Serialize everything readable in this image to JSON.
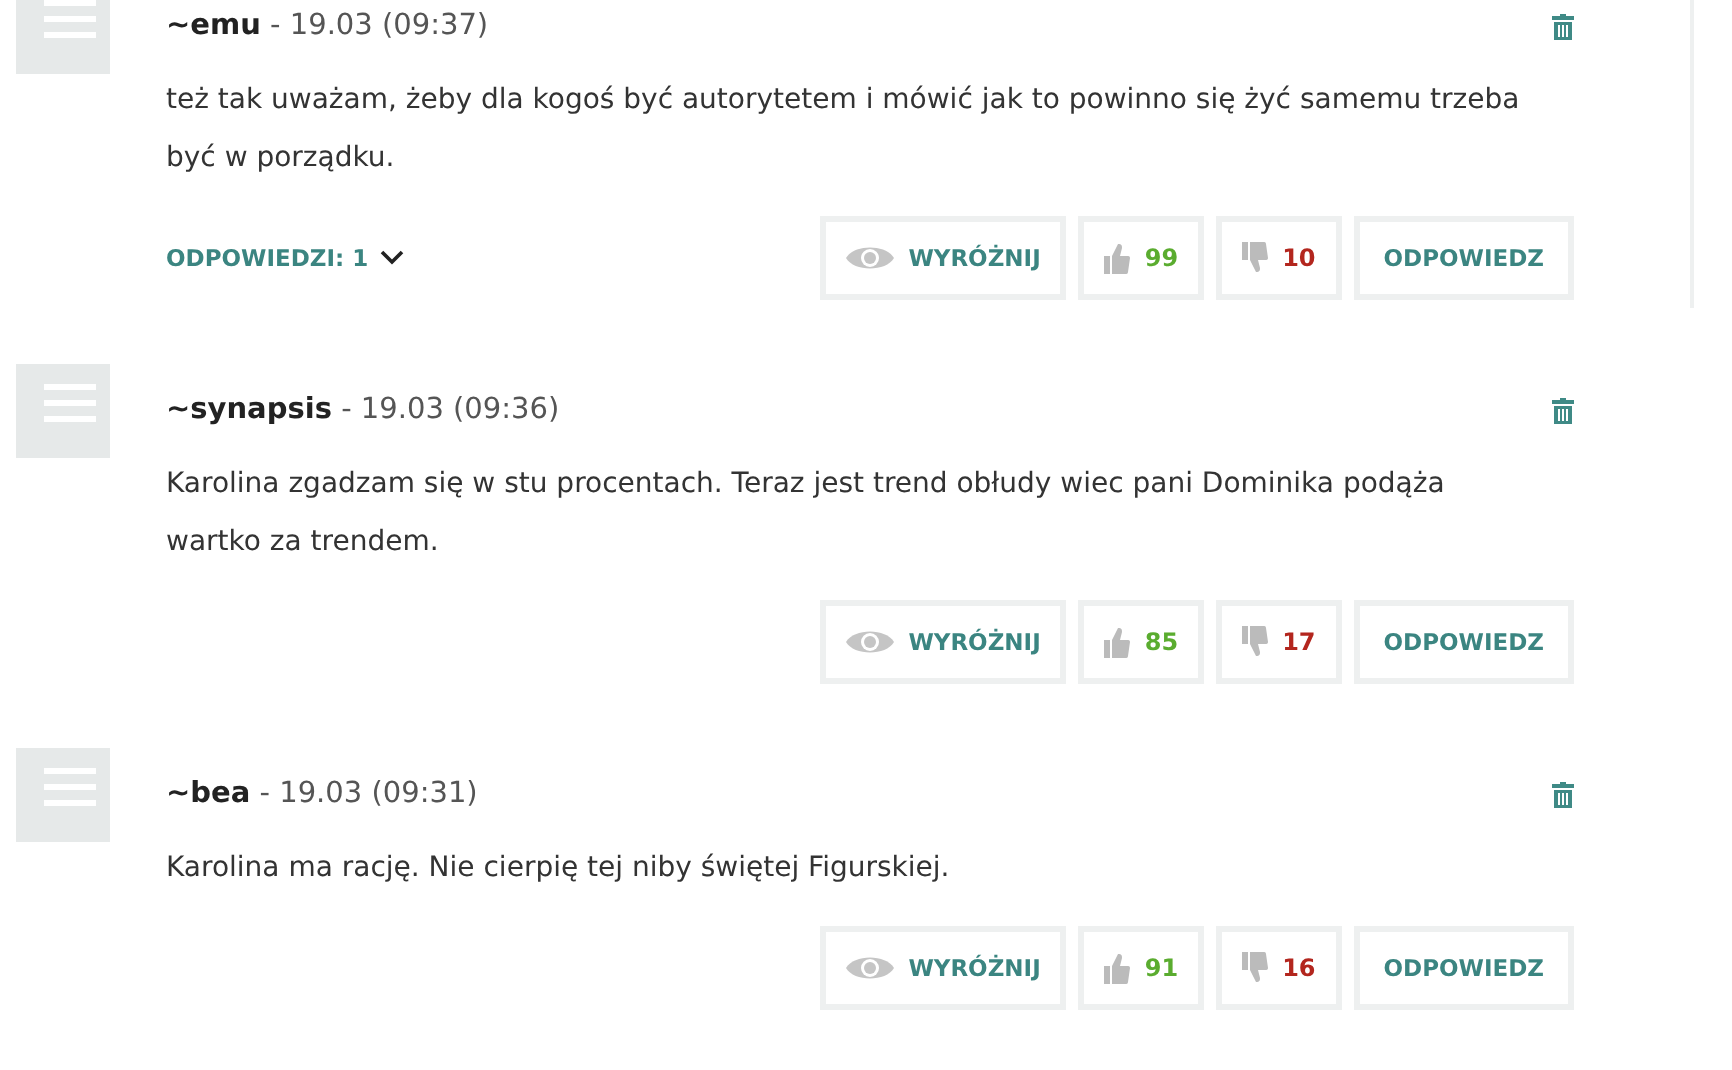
{
  "comments": [
    {
      "author": "~emu",
      "date": "- 19.03 (09:37)",
      "text": "też tak uważam, żeby dla kogoś być autorytetem i mówić jak to powinno się żyć samemu trzeba być w porządku.",
      "replies": {
        "label": "ODPOWIEDZI: 1",
        "expanded": false
      },
      "thread_line": true,
      "highlight": "WYRÓŻNIJ",
      "likes": "99",
      "dislikes": "10",
      "reply": "ODPOWIEDZ"
    },
    {
      "author": "~synapsis",
      "date": "- 19.03 (09:36)",
      "text": "Karolina zgadzam się w stu procentach. Teraz jest trend obłudy wiec pani Dominika podąża wartko za trendem.",
      "thread_line": false,
      "highlight": "WYRÓŻNIJ",
      "likes": "85",
      "dislikes": "17",
      "reply": "ODPOWIEDZ"
    },
    {
      "author": "~bea",
      "date": "- 19.03 (09:31)",
      "text": "Karolina ma rację. Nie cierpię tej niby świętej Figurskiej.",
      "thread_line": false,
      "highlight": "WYRÓŻNIJ",
      "likes": "91",
      "dislikes": "16",
      "reply": "ODPOWIEDZ"
    }
  ]
}
